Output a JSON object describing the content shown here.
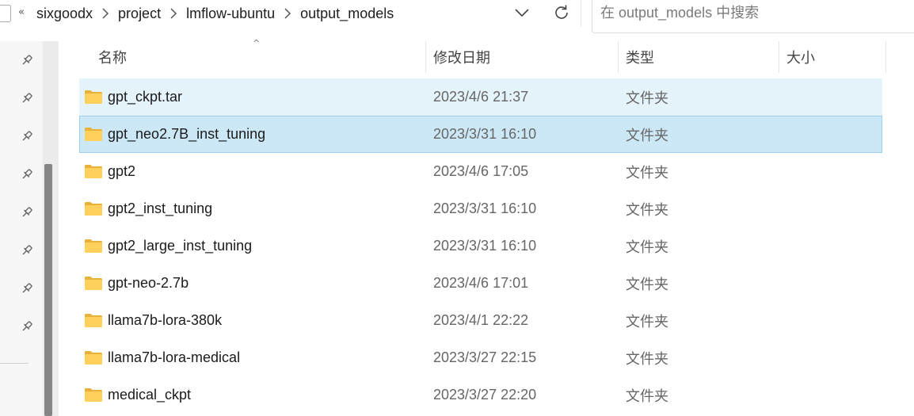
{
  "address": {
    "overflow": "«",
    "crumbs": [
      "sixgoodx",
      "project",
      "lmflow-ubuntu",
      "output_models"
    ]
  },
  "search": {
    "placeholder": "在 output_models 中搜索",
    "value": ""
  },
  "columns": {
    "name": "名称",
    "date": "修改日期",
    "type": "类型",
    "size": "大小"
  },
  "files": [
    {
      "name": "gpt_ckpt.tar",
      "date": "2023/4/6 21:37",
      "type": "文件夹",
      "size": ""
    },
    {
      "name": "gpt_neo2.7B_inst_tuning",
      "date": "2023/3/31 16:10",
      "type": "文件夹",
      "size": ""
    },
    {
      "name": "gpt2",
      "date": "2023/4/6 17:05",
      "type": "文件夹",
      "size": ""
    },
    {
      "name": "gpt2_inst_tuning",
      "date": "2023/3/31 16:10",
      "type": "文件夹",
      "size": ""
    },
    {
      "name": "gpt2_large_inst_tuning",
      "date": "2023/3/31 16:10",
      "type": "文件夹",
      "size": ""
    },
    {
      "name": "gpt-neo-2.7b",
      "date": "2023/4/6 17:01",
      "type": "文件夹",
      "size": ""
    },
    {
      "name": "llama7b-lora-380k",
      "date": "2023/4/1 22:22",
      "type": "文件夹",
      "size": ""
    },
    {
      "name": "llama7b-lora-medical",
      "date": "2023/3/27 22:15",
      "type": "文件夹",
      "size": ""
    },
    {
      "name": "medical_ckpt",
      "date": "2023/3/27 22:20",
      "type": "文件夹",
      "size": ""
    }
  ],
  "state": {
    "hover_row": 0,
    "selected_row": 1
  },
  "icons": {
    "folder": "folder-icon",
    "pin": "pin-icon",
    "refresh": "refresh-icon",
    "dropdown": "chevron-down-icon"
  },
  "colors": {
    "hover_bg": "#e5f3fb",
    "selected_bg": "#cce8f7",
    "selected_border": "#99d0ee",
    "folder": "#f8c94a"
  }
}
